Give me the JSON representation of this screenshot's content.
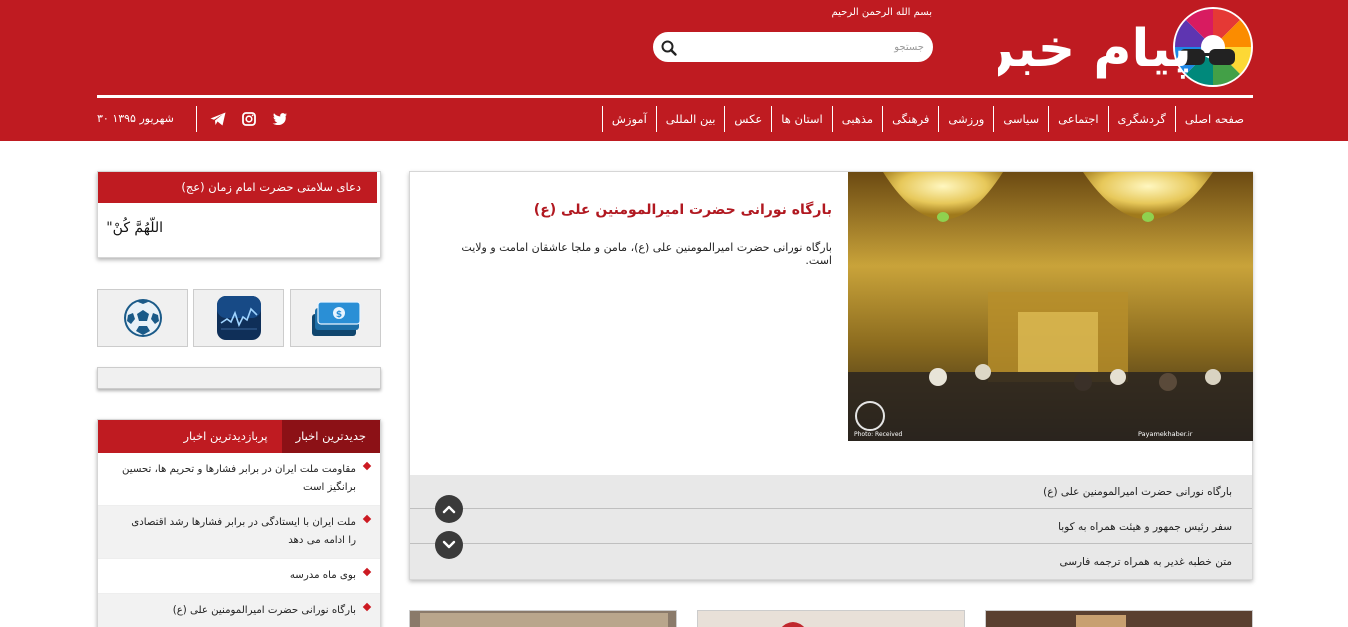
{
  "header": {
    "logo_text": "پیام خبر",
    "bismillah": "بسم الله الرحمن الرحیم",
    "search": {
      "placeholder": "جستجو"
    },
    "date": "۳۰ شهریور ۱۳۹۵",
    "social": [
      "telegram-icon",
      "instagram-icon",
      "twitter-icon"
    ]
  },
  "nav": {
    "items": [
      "صفحه اصلی",
      "گردشگری",
      "اجتماعی",
      "سیاسی",
      "ورزشی",
      "فرهنگی",
      "مذهبی",
      "استان ها",
      "عکس",
      "بین المللی",
      "آموزش"
    ]
  },
  "slider": {
    "title": "بارگاه نورانی حضرت امیرالمومنین علی (ع)",
    "description": "بارگاه نورانی حضرت امیرالمومنین علی (ع)، مامن و ملجا عاشقان امامت و ولایت است.",
    "image_watermark": "Payamekhaber.ir",
    "image_credit": "Photo: Received",
    "headlines": [
      "بارگاه نورانی حضرت امیرالمومنین علی (ع)",
      "سفر رئیس جمهور و هیئت همراه به کوبا",
      "متن خطبه غدیر به همراه ترجمه فارسی"
    ]
  },
  "sidebar": {
    "prayer": {
      "title": "دعای سلامتی حضرت امام زمان (عج)",
      "text": "\"اللّهُمَّ كُنْ"
    },
    "tiles": [
      "currency-icon",
      "stock-chart-icon",
      "football-icon"
    ],
    "news": {
      "tabs": [
        "جدیدترین اخبار",
        "پربازدیدترین اخبار"
      ],
      "active_tab": 0,
      "items": [
        "مقاومت ملت ایران در برابر فشارها و تحریم ها، تحسین برانگیز است",
        "ملت ایران با ایستادگی در برابر فشارها رشد اقتصادی را ادامه می دهد",
        "بوی ماه مدرسه",
        "بارگاه نورانی حضرت امیرالمومنین علی (ع)"
      ]
    }
  },
  "colors": {
    "brand_red": "#bf1b21",
    "dark_red": "#8c1116",
    "title_red": "#b11820"
  }
}
